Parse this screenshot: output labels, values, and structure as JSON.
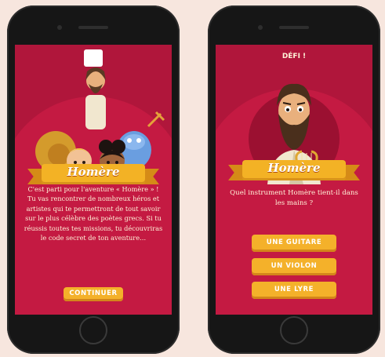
{
  "left_screen": {
    "ribbon_title": "Homère",
    "intro_paragraph": "C'est parti pour l'aventure « Homère » ! Tu vas rencontrer de nombreux héros et artistes qui te permettront de tout savoir sur le plus célèbre des poètes grecs. Si tu réussis toutes tes missions, tu découvriras le code secret de ton aventure…",
    "continue_label": "CONTINUER"
  },
  "right_screen": {
    "header_title": "DÉFI !",
    "ribbon_title": "Homère",
    "question": "Quel instrument Homère tient-il dans les mains ?",
    "answers": [
      "UNE GUITARE",
      "UN VIOLON",
      "UNE LYRE"
    ]
  },
  "colors": {
    "background": "#f7e6de",
    "screen_red": "#b0163b",
    "arch_red": "#c41a42",
    "button_yellow": "#f4b12a"
  }
}
